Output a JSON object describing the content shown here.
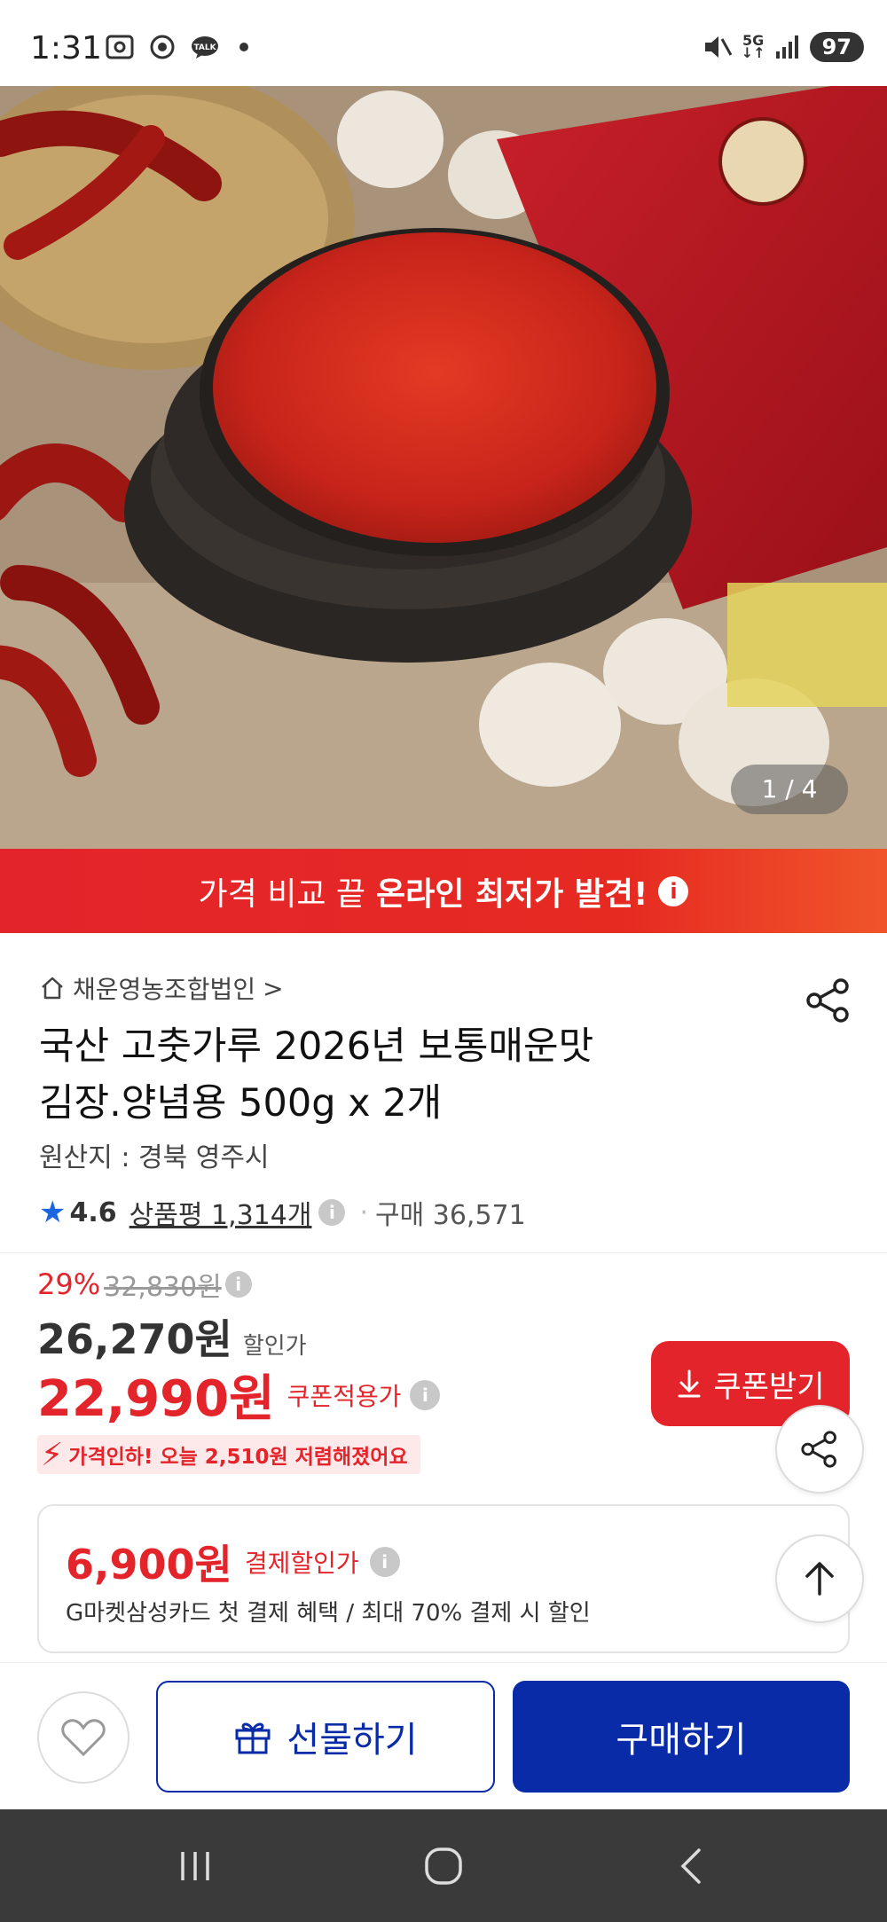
{
  "status_bar": {
    "time": "1:31",
    "network": "5G",
    "battery": "97"
  },
  "hero": {
    "image_counter": "1 / 4"
  },
  "banner": {
    "text": "가격 비교 끝",
    "emphasis": "온라인 최저가 발견!",
    "info_icon": "i"
  },
  "product": {
    "seller": "채운영농조합법인",
    "seller_chevron": ">",
    "title_line1": "국산 고춧가루 2026년 보통매운맛",
    "title_line2": "김장.양념용 500g x 2개",
    "origin": "원산지 : 경북 영주시",
    "rating": "4.6",
    "review_label": "상품평 1,314개",
    "purchase_count": "구매 36,571"
  },
  "price": {
    "discount_pct": "29%",
    "original_price": "32,830원",
    "sale_price": "26,270원",
    "sale_label": "할인가",
    "coupon_price": "22,990원",
    "coupon_label": "쿠폰적용가",
    "coupon_button": "쿠폰받기",
    "price_drop": "가격인하! 오늘 2,510원 저렴해졌어요"
  },
  "payment": {
    "price": "6,900원",
    "label": "결제할인가",
    "description": "G마켓삼성카드 첫 결제 혜택 / 최대 70% 결제 시 할인"
  },
  "actions": {
    "gift": "선물하기",
    "buy": "구매하기"
  },
  "colors": {
    "accent_red": "#e3242b",
    "brand_blue": "#0a2ba8",
    "rating_star": "#1a66e0"
  }
}
